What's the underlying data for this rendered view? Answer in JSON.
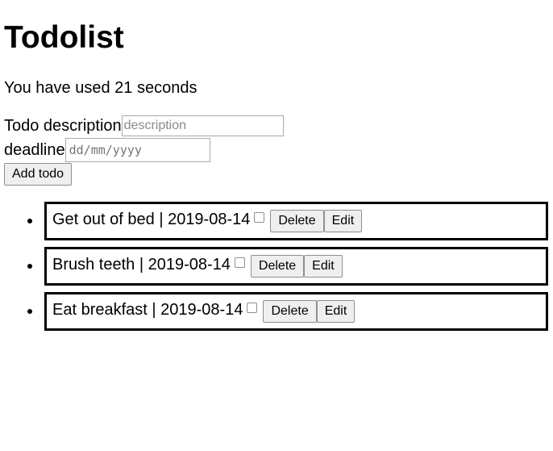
{
  "title": "Todolist",
  "timer": {
    "text": "You have used 21 seconds"
  },
  "form": {
    "description_label": "Todo description",
    "description_placeholder": "description",
    "deadline_label": "deadline",
    "deadline_placeholder": "dd/mm/yyyy",
    "add_button": "Add todo"
  },
  "todos": [
    {
      "text": "Get out of bed | 2019-08-14",
      "checked": false,
      "delete_label": "Delete",
      "edit_label": "Edit"
    },
    {
      "text": "Brush teeth | 2019-08-14",
      "checked": false,
      "delete_label": "Delete",
      "edit_label": "Edit"
    },
    {
      "text": "Eat breakfast | 2019-08-14",
      "checked": false,
      "delete_label": "Delete",
      "edit_label": "Edit"
    }
  ]
}
